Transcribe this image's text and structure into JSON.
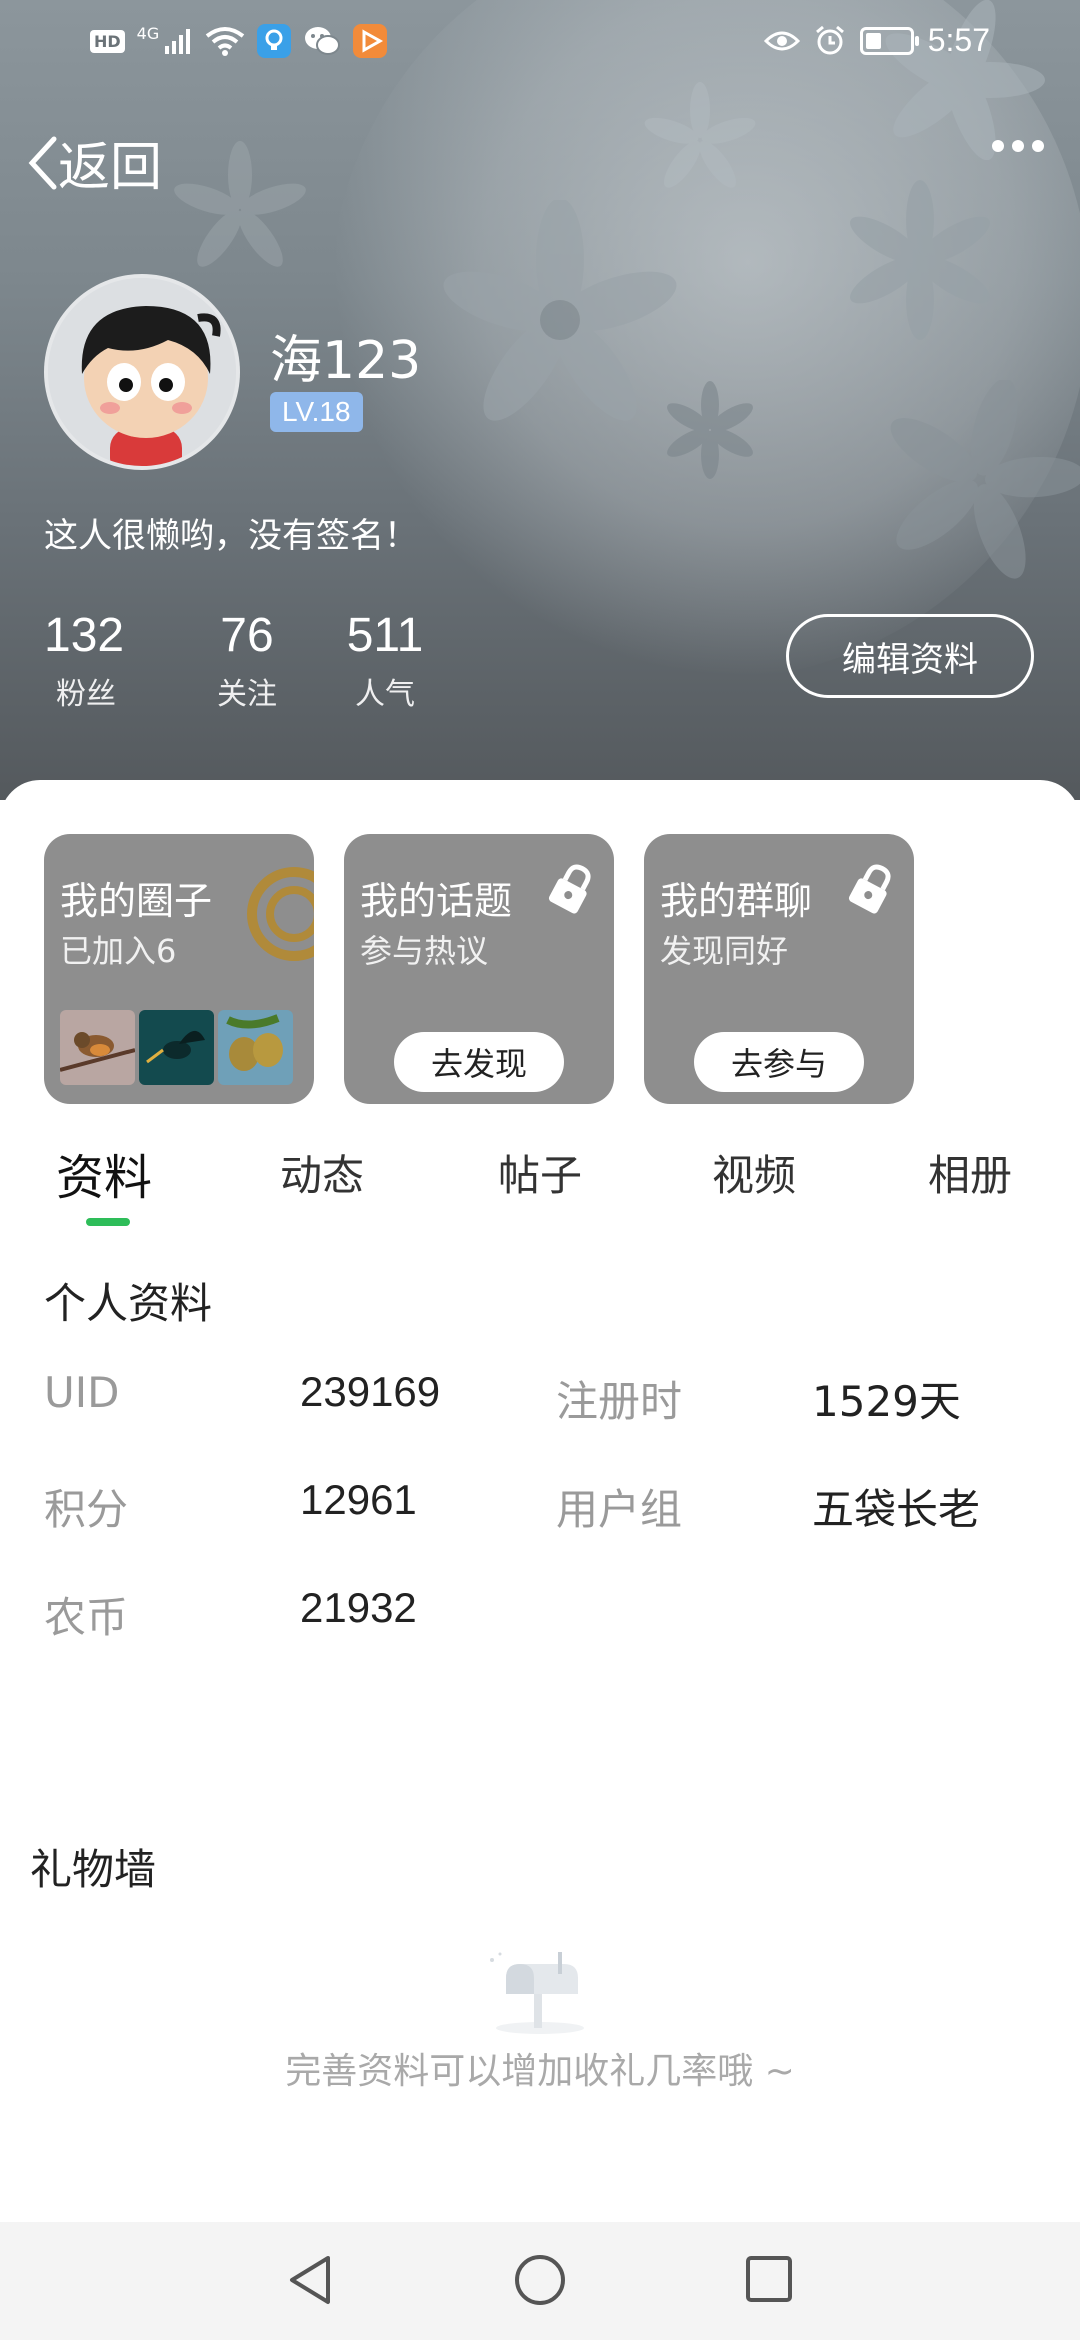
{
  "status_bar": {
    "hd": "HD",
    "network": "4G",
    "time": "5:57",
    "battery_level": 0.35,
    "icons": [
      "hd-icon",
      "signal-icon",
      "wifi-icon",
      "bulb-app-icon",
      "wechat-icon",
      "video-app-icon",
      "eye-icon",
      "alarm-icon",
      "battery-icon"
    ]
  },
  "nav": {
    "back_label": "返回",
    "more_icon": "more-dots-icon"
  },
  "profile": {
    "username": "海123",
    "level": "LV.18",
    "signature": "这人很懒哟，没有签名！",
    "stats": [
      {
        "value": "132",
        "label": "粉丝"
      },
      {
        "value": "76",
        "label": "关注"
      },
      {
        "value": "511",
        "label": "人气"
      }
    ],
    "edit_button": "编辑资料"
  },
  "cards": [
    {
      "title": "我的圈子",
      "subtitle": "已加入6",
      "button": "",
      "locked": false
    },
    {
      "title": "我的话题",
      "subtitle": "参与热议",
      "button": "去发现",
      "locked": true
    },
    {
      "title": "我的群聊",
      "subtitle": "发现同好",
      "button": "去参与",
      "locked": true
    }
  ],
  "tabs": [
    "资料",
    "动态",
    "帖子",
    "视频",
    "相册"
  ],
  "active_tab": "资料",
  "accent_color": "#2ebd59",
  "personal_info": {
    "title": "个人资料",
    "rows": [
      {
        "k1": "UID",
        "v1": "239169",
        "k2": "注册时",
        "v2": "1529天"
      },
      {
        "k1": "积分",
        "v1": "12961",
        "k2": "用户组",
        "v2": "五袋长老"
      },
      {
        "k1": "农币",
        "v1": "21932",
        "k2": "",
        "v2": ""
      }
    ]
  },
  "gift_wall": {
    "title": "礼物墙",
    "empty_text": "完善资料可以增加收礼几率哦 ~",
    "empty_icon": "mailbox-icon"
  },
  "system_nav": [
    "back-triangle-icon",
    "home-circle-icon",
    "recents-square-icon"
  ]
}
